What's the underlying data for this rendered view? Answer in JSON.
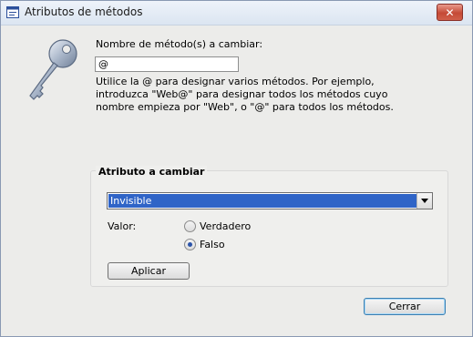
{
  "window": {
    "title": "Atributos de métodos",
    "close_symbol": "✕"
  },
  "form": {
    "method_label": "Nombre de método(s) a cambiar:",
    "method_value": "@",
    "help_text": "Utilice la @ para designar varios métodos. Por ejemplo, introduzca \"Web@\" para designar todos los métodos cuyo nombre empieza por \"Web\", o \"@\" para todos los métodos."
  },
  "attribute_panel": {
    "title": "Atributo a cambiar",
    "selected_attribute": "Invisible",
    "value_label": "Valor:",
    "options": [
      {
        "label": "Verdadero",
        "selected": false
      },
      {
        "label": "Falso",
        "selected": true
      }
    ],
    "apply_label": "Aplicar"
  },
  "footer": {
    "close_label": "Cerrar"
  },
  "icons": {
    "app": "app-window-icon",
    "key": "key-icon",
    "dropdown": "chevron-down-icon"
  },
  "colors": {
    "selection": "#2f64c7",
    "close_button": "#c54a36"
  }
}
